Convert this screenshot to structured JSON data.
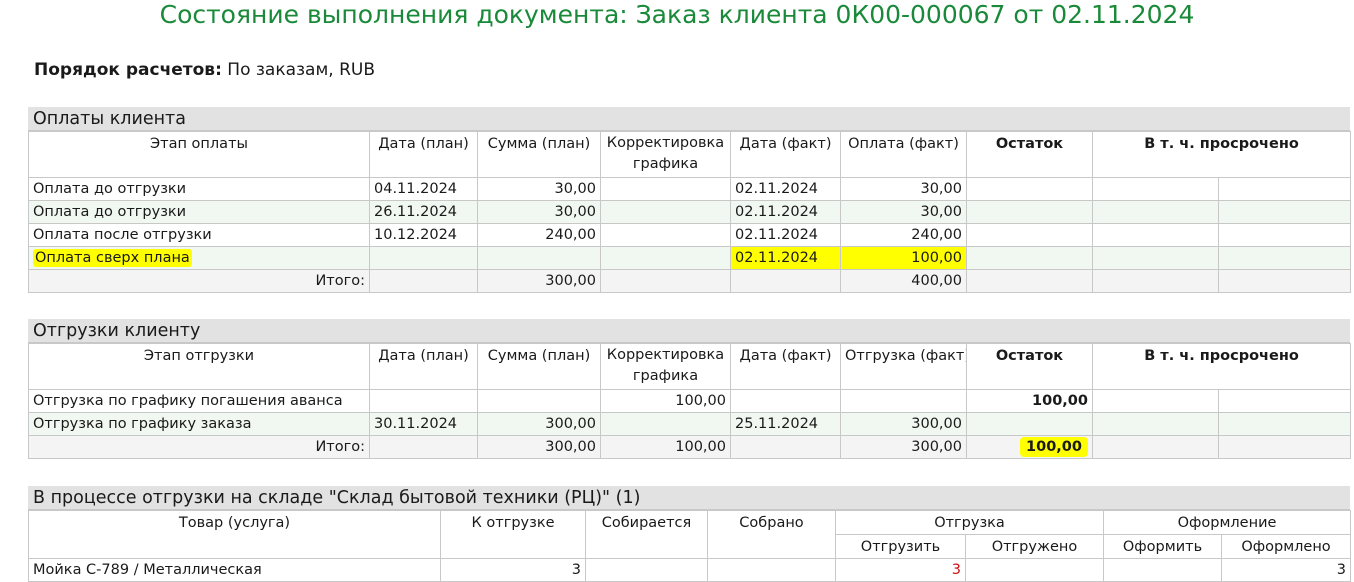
{
  "title": "Состояние выполнения документа: Заказ клиента 0К00-000067 от 02.11.2024",
  "settlement": {
    "label": "Порядок расчетов:",
    "value": "По заказам, RUB"
  },
  "payments": {
    "header": "Оплаты клиента",
    "columns": {
      "stage": "Этап оплаты",
      "date_plan": "Дата (план)",
      "sum_plan": "Сумма (план)",
      "correction": "Корректировка графика",
      "date_fact": "Дата (факт)",
      "fact": "Оплата (факт)",
      "remainder": "Остаток",
      "overdue": "В т. ч. просрочено"
    },
    "rows": [
      {
        "stage": "Оплата до отгрузки",
        "date_plan": "04.11.2024",
        "sum_plan": "30,00",
        "correction": "",
        "date_fact": "02.11.2024",
        "fact": "30,00",
        "remainder": "",
        "overdue1": "",
        "overdue2": ""
      },
      {
        "stage": "Оплата до отгрузки",
        "date_plan": "26.11.2024",
        "sum_plan": "30,00",
        "correction": "",
        "date_fact": "02.11.2024",
        "fact": "30,00",
        "remainder": "",
        "overdue1": "",
        "overdue2": ""
      },
      {
        "stage": "Оплата после отгрузки",
        "date_plan": "10.12.2024",
        "sum_plan": "240,00",
        "correction": "",
        "date_fact": "02.11.2024",
        "fact": "240,00",
        "remainder": "",
        "overdue1": "",
        "overdue2": ""
      },
      {
        "stage": "Оплата сверх плана",
        "date_plan": "",
        "sum_plan": "",
        "correction": "",
        "date_fact": "02.11.2024",
        "fact": "100,00",
        "remainder": "",
        "overdue1": "",
        "overdue2": ""
      }
    ],
    "total": {
      "label": "Итого:",
      "sum_plan": "300,00",
      "fact": "400,00"
    }
  },
  "shipments": {
    "header": "Отгрузки клиенту",
    "columns": {
      "stage": "Этап отгрузки",
      "date_plan": "Дата (план)",
      "sum_plan": "Сумма (план)",
      "correction": "Корректировка графика",
      "date_fact": "Дата (факт)",
      "fact": "Отгрузка (факт)",
      "remainder": "Остаток",
      "overdue": "В т. ч. просрочено"
    },
    "rows": [
      {
        "stage": "Отгрузка по графику погашения аванса",
        "date_plan": "",
        "sum_plan": "",
        "correction": "100,00",
        "date_fact": "",
        "fact": "",
        "remainder": "100,00",
        "overdue1": "",
        "overdue2": ""
      },
      {
        "stage": "Отгрузка по графику заказа",
        "date_plan": "30.11.2024",
        "sum_plan": "300,00",
        "correction": "",
        "date_fact": "25.11.2024",
        "fact": "300,00",
        "remainder": "",
        "overdue1": "",
        "overdue2": ""
      }
    ],
    "total": {
      "label": "Итого:",
      "sum_plan": "300,00",
      "correction": "100,00",
      "fact": "300,00",
      "remainder": "100,00"
    }
  },
  "warehouse": {
    "header": "В процессе отгрузки на складе \"Склад бытовой техники (РЦ)\" (1)",
    "columns": {
      "item": "Товар (услуга)",
      "to_ship": "К отгрузке",
      "collecting": "Собирается",
      "collected": "Собрано",
      "shipment": "Отгрузка",
      "ship_todo": "Отгрузить",
      "shipped": "Отгружено",
      "paperwork": "Оформление",
      "paper_todo": "Оформить",
      "papered": "Оформлено"
    },
    "rows": [
      {
        "item": "Мойка С-789 / Металлическая",
        "to_ship": "3",
        "collecting": "",
        "collected": "",
        "ship_todo": "3",
        "shipped": "",
        "paper_todo": "",
        "papered": "3"
      }
    ]
  },
  "colors": {
    "title": "#1a8a3a",
    "highlight": "#ffff00",
    "alert": "#cc1111",
    "row_alt": "#f1f8f1"
  }
}
